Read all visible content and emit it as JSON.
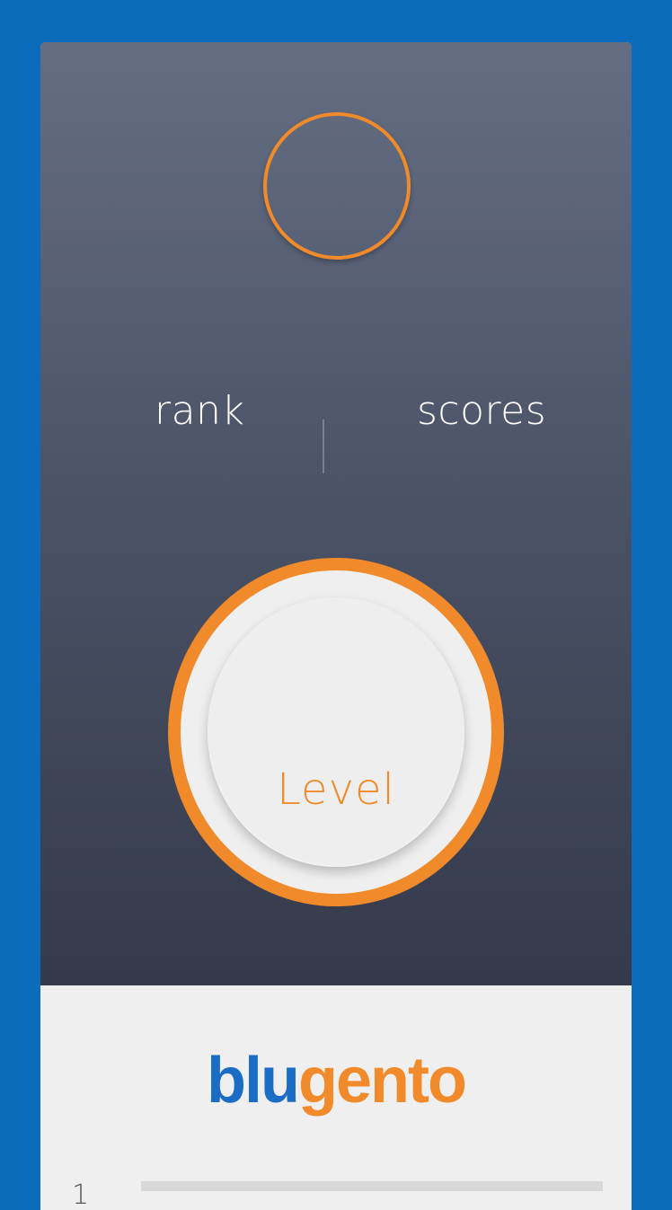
{
  "profile": {
    "stats": {
      "rank_label": "rank",
      "scores_label": "scores"
    },
    "level_button_label": "Level"
  },
  "brand": {
    "part1": "blu",
    "part2": "gento"
  },
  "leaderboard": {
    "rows": [
      {
        "position": "1"
      }
    ]
  },
  "colors": {
    "background": "#0a6cba",
    "accent": "#f08a2a",
    "brand_blue": "#1a6cc4",
    "header_top": "#646e83",
    "header_bottom": "#343a4a"
  }
}
